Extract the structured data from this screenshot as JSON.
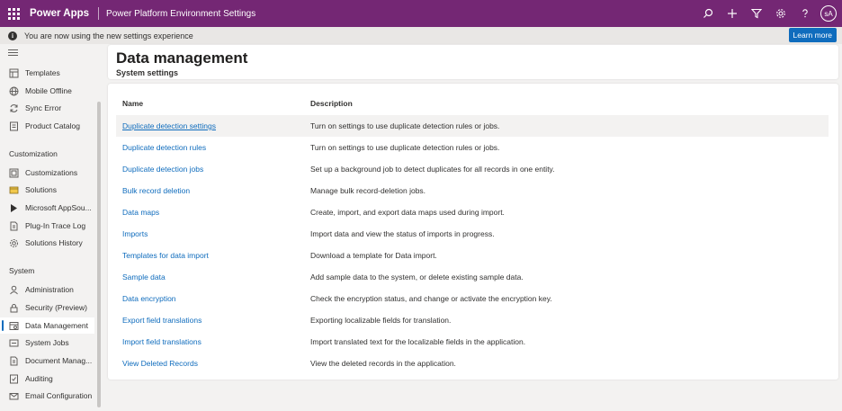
{
  "topbar": {
    "app_name": "Power Apps",
    "env_title": "Power Platform Environment Settings",
    "avatar": "sA",
    "icons": [
      "search-icon",
      "add-icon",
      "filter-icon",
      "settings-icon",
      "help-icon"
    ]
  },
  "banner": {
    "message": "You are now using the new settings experience",
    "learn_more": "Learn more"
  },
  "sidebar": {
    "items_top": [
      {
        "label": "Templates",
        "icon": "templates-icon"
      },
      {
        "label": "Mobile Offline",
        "icon": "globe-icon"
      },
      {
        "label": "Sync Error",
        "icon": "sync-icon"
      },
      {
        "label": "Product Catalog",
        "icon": "catalog-icon"
      }
    ],
    "customization_header": "Customization",
    "customization_items": [
      {
        "label": "Customizations",
        "icon": "customizations-icon"
      },
      {
        "label": "Solutions",
        "icon": "solutions-icon"
      },
      {
        "label": "Microsoft AppSou...",
        "icon": "appsource-icon"
      },
      {
        "label": "Plug-In Trace Log",
        "icon": "document-icon"
      },
      {
        "label": "Solutions History",
        "icon": "gear-icon"
      }
    ],
    "system_header": "System",
    "system_items": [
      {
        "label": "Administration",
        "icon": "person-icon"
      },
      {
        "label": "Security (Preview)",
        "icon": "lock-icon"
      },
      {
        "label": "Data Management",
        "icon": "data-icon"
      },
      {
        "label": "System Jobs",
        "icon": "jobs-icon"
      },
      {
        "label": "Document Manag...",
        "icon": "document-icon"
      },
      {
        "label": "Auditing",
        "icon": "auditing-icon"
      },
      {
        "label": "Email Configuration",
        "icon": "email-icon"
      }
    ],
    "active": "Data Management"
  },
  "header": {
    "title": "Data management",
    "subtitle": "System settings"
  },
  "table": {
    "columns": [
      "Name",
      "Description"
    ],
    "rows": [
      {
        "name": "Duplicate detection settings",
        "description": "Turn on settings to use duplicate detection rules or jobs."
      },
      {
        "name": "Duplicate detection rules",
        "description": "Turn on settings to use duplicate detection rules or jobs."
      },
      {
        "name": "Duplicate detection jobs",
        "description": "Set up a background job to detect duplicates for all records in one entity."
      },
      {
        "name": "Bulk record deletion",
        "description": "Manage bulk record-deletion jobs."
      },
      {
        "name": "Data maps",
        "description": "Create, import, and export data maps used during import."
      },
      {
        "name": "Imports",
        "description": "Import data and view the status of imports in progress."
      },
      {
        "name": "Templates for data import",
        "description": "Download a template for Data import."
      },
      {
        "name": "Sample data",
        "description": "Add sample data to the system, or delete existing sample data."
      },
      {
        "name": "Data encryption",
        "description": "Check the encryption status, and change or activate the encryption key."
      },
      {
        "name": "Export field translations",
        "description": "Exporting localizable fields for translation."
      },
      {
        "name": "Import field translations",
        "description": "Import translated text for the localizable fields in the application."
      },
      {
        "name": "View Deleted Records",
        "description": "View the deleted records in the application."
      }
    ]
  },
  "colors": {
    "brand": "#742774",
    "accent": "#0f6cbd",
    "link": "#0f6cbd",
    "surface": "#ffffff",
    "background": "#f3f2f1"
  }
}
